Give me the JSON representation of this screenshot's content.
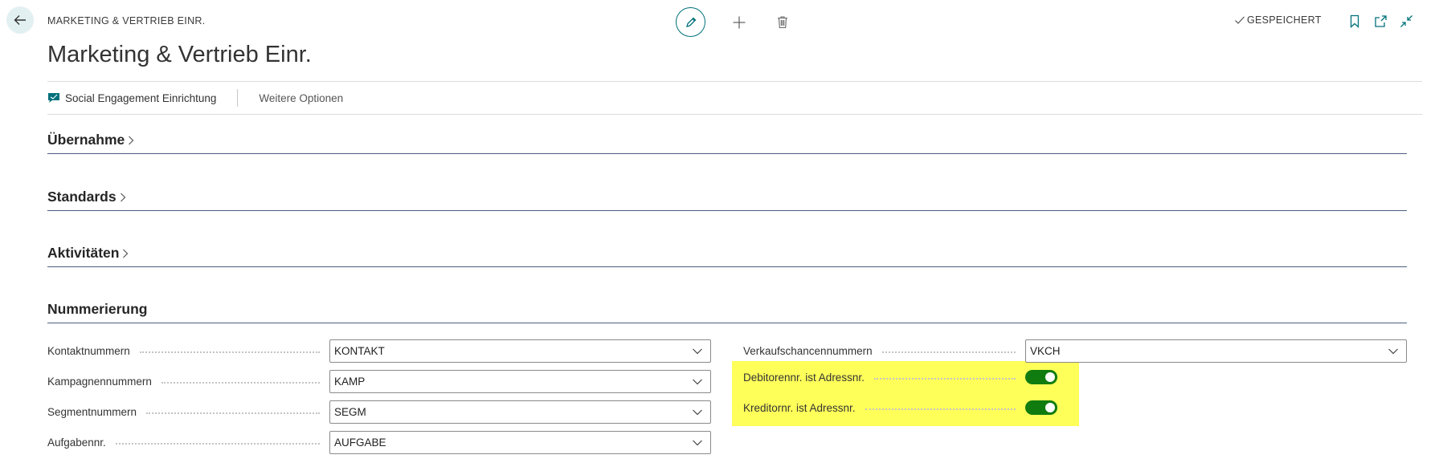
{
  "header": {
    "caption": "MARKETING & VERTRIEB EINR.",
    "title": "Marketing & Vertrieb Einr.",
    "saved_label": "GESPEICHERT"
  },
  "actions": {
    "social": "Social Engagement Einrichtung",
    "more": "Weitere Optionen"
  },
  "sections": [
    {
      "title": "Übernahme"
    },
    {
      "title": "Standards"
    },
    {
      "title": "Aktivitäten"
    },
    {
      "title": "Nummerierung"
    }
  ],
  "numbering": {
    "left": [
      {
        "label": "Kontaktnummern",
        "value": "KONTAKT"
      },
      {
        "label": "Kampagnennummern",
        "value": "KAMP"
      },
      {
        "label": "Segmentnummern",
        "value": "SEGM"
      },
      {
        "label": "Aufgabennr.",
        "value": "AUFGABE"
      }
    ],
    "right": [
      {
        "label": "Verkaufschancennummern",
        "value": "VKCH"
      }
    ],
    "toggles": [
      {
        "label": "Debitorennr. ist Adressnr.",
        "on": true
      },
      {
        "label": "Kreditornr. ist Adressnr.",
        "on": true
      }
    ]
  },
  "colors": {
    "accent": "#00707a",
    "toggle_on": "#107c10",
    "highlight": "#ffff5a"
  },
  "icons": [
    "back-arrow-icon",
    "pencil-icon",
    "plus-icon",
    "trash-icon",
    "checkmark-icon",
    "bookmark-icon",
    "open-new-window-icon",
    "collapse-icon",
    "social-engagement-icon",
    "chevron-right-icon",
    "chevron-down-icon"
  ]
}
